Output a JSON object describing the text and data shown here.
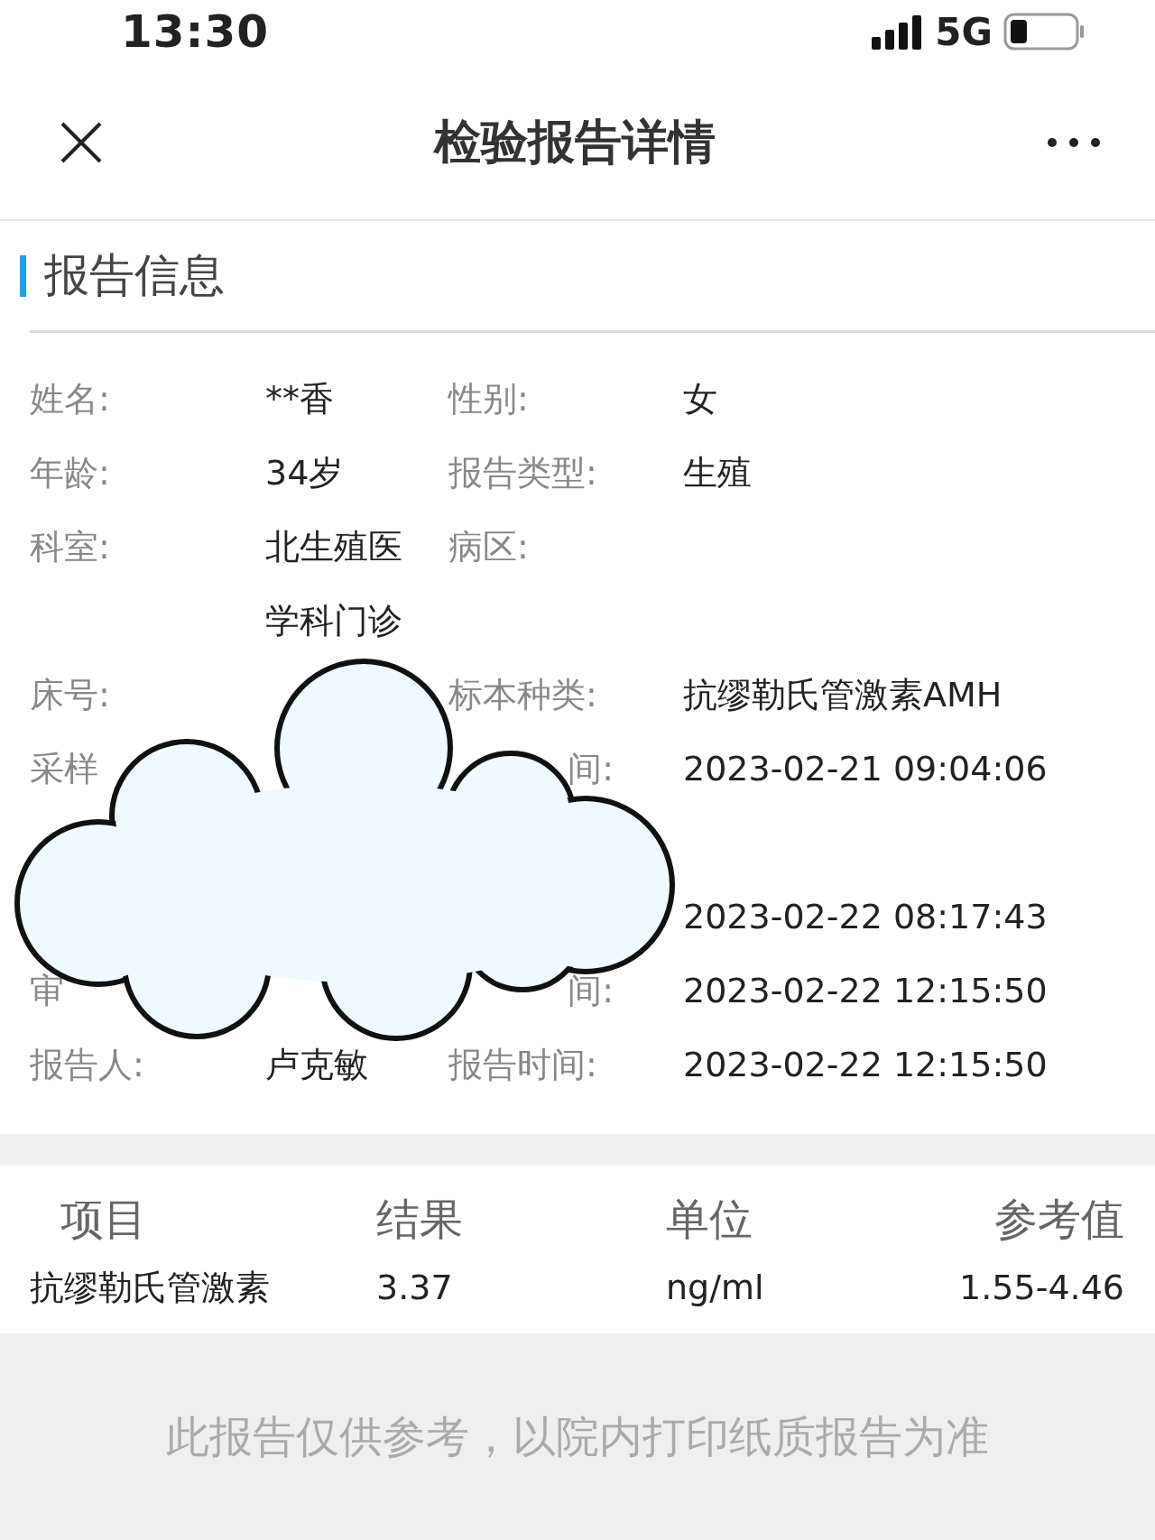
{
  "status_bar": {
    "time": "13:30",
    "network": "5G"
  },
  "header": {
    "title": "检验报告详情"
  },
  "section": {
    "title": "报告信息"
  },
  "info_rows": [
    {
      "kind": "pair",
      "left": {
        "label": "姓名:",
        "value": "**香"
      },
      "right": {
        "label": "性别:",
        "value": "女"
      }
    },
    {
      "kind": "pair",
      "left": {
        "label": "年龄:",
        "value": "34岁"
      },
      "right": {
        "label": "报告类型:",
        "value": "生殖"
      }
    },
    {
      "kind": "pair",
      "left": {
        "label": "科室:",
        "value": "北生殖医学科门诊"
      },
      "right": {
        "label": "病区:"
      }
    },
    {
      "kind": "pair",
      "left": {
        "label": "床号:"
      },
      "right": {
        "label": "标本种类:",
        "value": "抗缪勒氏管激素AMH"
      }
    },
    {
      "kind": "pair",
      "left": {
        "label": "采样"
      },
      "right": {
        "label": "间:",
        "clipped": true,
        "value": "2023-02-21 09:04:06"
      }
    },
    {
      "kind": "covered"
    },
    {
      "kind": "pair",
      "right": {
        "value": "2023-02-22 08:17:43"
      }
    },
    {
      "kind": "pair",
      "left": {
        "label": "审"
      },
      "right": {
        "label": "间:",
        "clipped": true,
        "value": "2023-02-22 12:15:50"
      }
    },
    {
      "kind": "pair",
      "left": {
        "label": "报告人:",
        "value": "卢克敏"
      },
      "right": {
        "label": "报告时间:",
        "value": "2023-02-22 12:15:50"
      }
    }
  ],
  "results": {
    "columns": [
      "项目",
      "结果",
      "单位",
      "参考值"
    ],
    "rows": [
      [
        "抗缪勒氏管激素",
        "3.37",
        "ng/ml",
        "1.55-4.46"
      ]
    ]
  },
  "footer": {
    "note": "此报告仅供参考，以院内打印纸质报告为准"
  }
}
